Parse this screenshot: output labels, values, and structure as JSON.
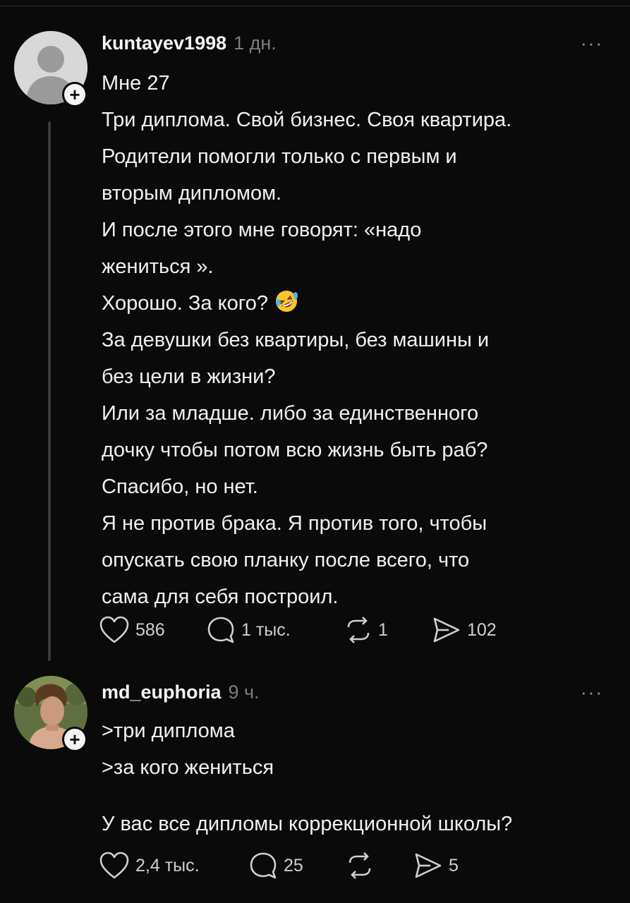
{
  "posts": [
    {
      "username": "kuntayev1998",
      "time": "1 дн.",
      "more": "···",
      "lines": [
        "Мне 27",
        "Три  диплома. Свой бизнес. Своя квартира.",
        "Родители помогли только с первым и",
        "вторым дипломом.",
        "И после этого мне говорят: «надо",
        "жениться ».",
        "Хорошо. За кого?",
        "За девушки без квартиры, без машины и",
        "без цели в жизни?",
        "Или за младше. либо за единственного",
        "дочку  чтобы потом всю жизнь быть раб?",
        "Спасибо, но нет.",
        "Я не против брака. Я против того, чтобы",
        "опускать свою планку после всего, что",
        "сама для себя построил."
      ],
      "emoji": "rolling-on-floor-laughing-emoji",
      "likes": "586",
      "comments": "1 тыс.",
      "reposts": "1",
      "shares": "102"
    },
    {
      "username": "md_euphoria",
      "time": "9 ч.",
      "more": "···",
      "lines": [
        ">три диплома",
        ">за кого жениться",
        "У вас все дипломы коррекционной школы?"
      ],
      "likes": "2,4 тыс.",
      "comments": "25",
      "reposts": "",
      "shares": "5"
    }
  ],
  "icons": {
    "heart": "heart-icon",
    "comment": "comment-icon",
    "repost": "repost-icon",
    "share": "share-icon",
    "plus": "+"
  },
  "colors": {
    "background": "#0a0a0a",
    "text": "#f1f1f1",
    "muted": "#7d7d7d"
  }
}
